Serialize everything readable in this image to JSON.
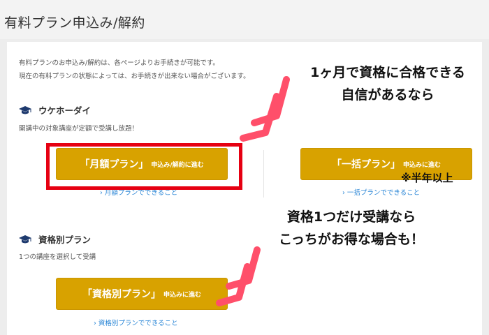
{
  "header": {
    "title": "有料プラン申込み/解約"
  },
  "intro": {
    "line1": "有料プランのお申込み/解約は、各ページよりお手続きが可能です。",
    "line2": "現在の有料プランの状態によっては、お手続きが出来ない場合がございます。"
  },
  "ukehodai": {
    "title": "ウケホーダイ",
    "desc": "開講中の対象講座が定額で受講し放題！",
    "monthly": {
      "main": "「月額プラン」",
      "sub": "申込み/解約に進む",
      "link": "› 月額プランでできること"
    },
    "lump": {
      "main": "「一括プラン」",
      "sub": "申込みに進む",
      "link": "› 一括プランでできること"
    }
  },
  "shikakubetsu": {
    "title": "資格別プラン",
    "desc": "1つの講座を選択して受講",
    "btn": {
      "main": "「資格別プラン」",
      "sub": "申込みに進む",
      "link": "› 資格別プランでできること"
    }
  },
  "annotations": {
    "top_line1": "1ヶ月で資格に合格できる",
    "top_line2": "自信があるなら",
    "half_year": "※半年以上",
    "bottom_line1": "資格1つだけ受講なら",
    "bottom_line2": "こっちがお得な場合も！"
  },
  "colors": {
    "button": "#d8a200",
    "link": "#2a86d6",
    "highlight": "#e60012",
    "chevron": "#ff4f6a"
  },
  "icons": {
    "section": "graduation-cap-icon",
    "arrow": "pink-chevron-arrow-icon"
  }
}
